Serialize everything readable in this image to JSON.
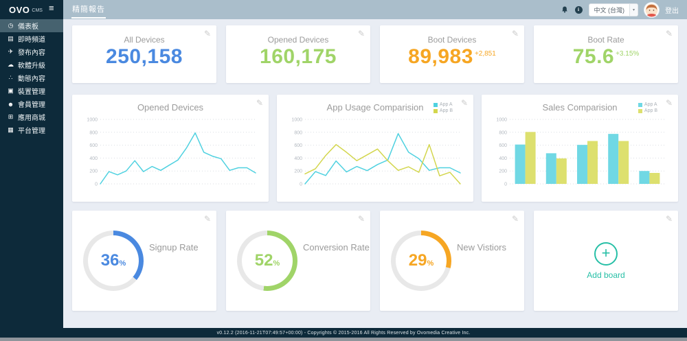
{
  "logo": {
    "text": "OVO",
    "suffix": "CMS"
  },
  "icons": {
    "edit": "✎",
    "hamburger": "≡",
    "caret": "▾",
    "plus": "+",
    "info": "i"
  },
  "header": {
    "tab": "精簡報告",
    "language": "中文 (台灣)",
    "logout": "登出"
  },
  "sidebar": {
    "items": [
      {
        "label": "儀表板",
        "icon": "dashboard-icon",
        "glyph": "◷",
        "active": true
      },
      {
        "label": "即時頻道",
        "icon": "live-channels-icon",
        "glyph": "▤",
        "active": false
      },
      {
        "label": "發布內容",
        "icon": "publish-content-icon",
        "glyph": "✈",
        "active": false
      },
      {
        "label": "軟體升級",
        "icon": "software-upgrade-icon",
        "glyph": "☁",
        "active": false
      },
      {
        "label": "動態內容",
        "icon": "dynamic-content-icon",
        "glyph": "∴",
        "active": false
      },
      {
        "label": "裝置管理",
        "icon": "device-management-icon",
        "glyph": "▣",
        "active": false
      },
      {
        "label": "會員管理",
        "icon": "member-management-icon",
        "glyph": "☻",
        "active": false
      },
      {
        "label": "應用商城",
        "icon": "app-store-icon",
        "glyph": "⊞",
        "active": false
      },
      {
        "label": "平台管理",
        "icon": "platform-management-icon",
        "glyph": "▦",
        "active": false
      }
    ]
  },
  "stats": [
    {
      "title": "All Devices",
      "value": "250,158",
      "delta": "",
      "color": "#4a89e0"
    },
    {
      "title": "Opened Devices",
      "value": "160,175",
      "delta": "",
      "color": "#a0d468"
    },
    {
      "title": "Boot Devices",
      "value": "89,983",
      "delta": "+2,851",
      "color": "#f6a623"
    },
    {
      "title": "Boot Rate",
      "value": "75.6",
      "delta": "+3.15%",
      "color": "#a0d468"
    }
  ],
  "chart_data": [
    {
      "type": "line",
      "title": "Opened Devices",
      "ylim": [
        0,
        1000
      ],
      "yticks": [
        0,
        200,
        400,
        600,
        800,
        1000
      ],
      "grid": true,
      "legend": null,
      "series": [
        {
          "name": "Opened Devices",
          "color": "#4fd1e0",
          "values": [
            0,
            190,
            140,
            200,
            360,
            190,
            270,
            210,
            290,
            370,
            560,
            790,
            490,
            430,
            390,
            210,
            250,
            250,
            170
          ]
        }
      ]
    },
    {
      "type": "line",
      "title": "App Usage Comparision",
      "ylim": [
        0,
        1000
      ],
      "yticks": [
        0,
        200,
        400,
        600,
        800,
        1000
      ],
      "grid": true,
      "legend_position": "top-right",
      "series": [
        {
          "name": "App A",
          "color": "#4fd1e0",
          "values": [
            0,
            190,
            130,
            355,
            185,
            270,
            205,
            300,
            370,
            780,
            490,
            390,
            210,
            250,
            250,
            170
          ]
        },
        {
          "name": "App B",
          "color": "#d3d64d",
          "values": [
            155,
            235,
            440,
            610,
            490,
            360,
            450,
            540,
            360,
            210,
            265,
            180,
            610,
            125,
            180,
            0
          ]
        }
      ]
    },
    {
      "type": "bar",
      "title": "Sales Comparision",
      "ylim": [
        0,
        1000
      ],
      "yticks": [
        0,
        200,
        400,
        600,
        800,
        1000
      ],
      "grid": true,
      "legend_position": "top-right",
      "series": [
        {
          "name": "App A",
          "color": "#70d8e4",
          "values": [
            610,
            475,
            605,
            775,
            200
          ]
        },
        {
          "name": "App B",
          "color": "#dde06e",
          "values": [
            805,
            395,
            665,
            665,
            170
          ]
        }
      ]
    }
  ],
  "donuts": [
    {
      "title": "Signup Rate",
      "percent": 36,
      "color": "#4a89e0",
      "track_color": "#e8e8e8"
    },
    {
      "title": "Conversion Rate",
      "percent": 52,
      "color": "#a0d468",
      "track_color": "#e8e8e8"
    },
    {
      "title": "New Vistiors",
      "percent": 29,
      "color": "#f6a623",
      "track_color": "#e8e8e8"
    }
  ],
  "add_board": {
    "label": "Add board"
  },
  "footer": {
    "text": "v0.12.2 (2016-11-21T07:49:57+00:00) - Copyrights © 2015-2016 All Rights Reserved by Ovomedia Creative Inc."
  }
}
